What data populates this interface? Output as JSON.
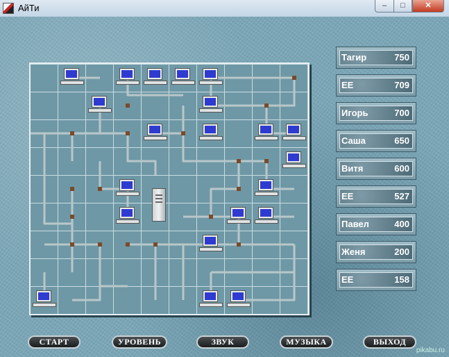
{
  "window": {
    "title": "АйТи",
    "minimize": "–",
    "maximize": "□",
    "close": "✕"
  },
  "leaderboard": [
    {
      "name": "Тагир",
      "score": "750"
    },
    {
      "name": "EE",
      "score": "709"
    },
    {
      "name": "Игорь",
      "score": "700"
    },
    {
      "name": "Саша",
      "score": "650"
    },
    {
      "name": "Витя",
      "score": "600"
    },
    {
      "name": "EE",
      "score": "527"
    },
    {
      "name": "Павел",
      "score": "400"
    },
    {
      "name": "Женя",
      "score": "200"
    },
    {
      "name": "EE",
      "score": "158"
    }
  ],
  "menu": {
    "start": "СТАРТ",
    "level": "УРОВЕНЬ",
    "sound": "ЗВУК",
    "music": "МУЗЫКА",
    "exit": "ВЫХОД"
  },
  "board": {
    "cols": 10,
    "rows": 9,
    "computers": [
      [
        1,
        0
      ],
      [
        3,
        0
      ],
      [
        4,
        0
      ],
      [
        5,
        0
      ],
      [
        6,
        0
      ],
      [
        2,
        1
      ],
      [
        6,
        1
      ],
      [
        4,
        2
      ],
      [
        6,
        2
      ],
      [
        8,
        2
      ],
      [
        9,
        2
      ],
      [
        9,
        3
      ],
      [
        3,
        4
      ],
      [
        8,
        4
      ],
      [
        3,
        5
      ],
      [
        7,
        5
      ],
      [
        8,
        5
      ],
      [
        6,
        6
      ],
      [
        0,
        8
      ],
      [
        6,
        8
      ],
      [
        7,
        8
      ]
    ],
    "server_cell": [
      4,
      5
    ],
    "colors": {
      "pipe": "#b8c7c9",
      "connector": "#7a4a2a",
      "screen": "#2f3bd0"
    }
  },
  "watermark": "pikabu.ru"
}
